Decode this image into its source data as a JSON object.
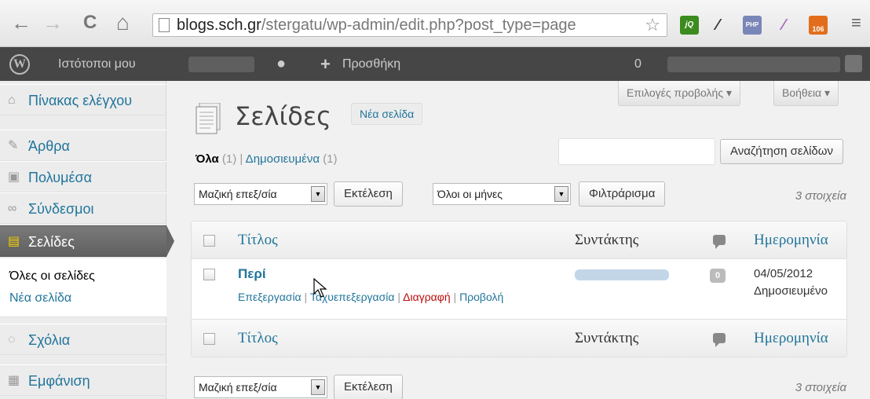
{
  "browser": {
    "back": "←",
    "forward": "→",
    "reload": "C",
    "home": "⌂",
    "url_host": "blogs.sch.gr",
    "url_path": "/stergatu/wp-admin/edit.php?post_type=page",
    "star": "☆",
    "extensions": [
      "jQ",
      "PHP",
      "106"
    ],
    "menu": "≡"
  },
  "adminbar": {
    "my_sites": "Ιστότοποι μου",
    "add_new": "Προσθήκη",
    "plus": "+",
    "count": "0"
  },
  "sidebar": {
    "items": [
      {
        "label": "Πίνακας ελέγχου",
        "icon": "⌂"
      },
      {
        "label": "Άρθρα",
        "icon": "✎"
      },
      {
        "label": "Πολυμέσα",
        "icon": "▣"
      },
      {
        "label": "Σύνδεσμοι",
        "icon": "∞"
      },
      {
        "label": "Σελίδες",
        "icon": "▤"
      },
      {
        "label": "Σχόλια",
        "icon": "◌"
      },
      {
        "label": "Εμφάνιση",
        "icon": "▦"
      }
    ],
    "submenu": [
      "Όλες οι σελίδες",
      "Νέα σελίδα"
    ]
  },
  "screen_options": "Επιλογές προβολής ▾",
  "help": "Βοήθεια ▾",
  "page_title": "Σελίδες",
  "add_new_page": "Νέα σελίδα",
  "filters": {
    "all_label": "Όλα",
    "all_count": " (1)",
    "sep": " | ",
    "published_label": "Δημοσιευμένα",
    "published_count": " (1)"
  },
  "search": {
    "placeholder": "",
    "button": "Αναζήτηση σελίδων"
  },
  "bulk": {
    "select_value": "Μαζική επεξ/σία",
    "apply": "Εκτέλεση"
  },
  "dates": {
    "select_value": "Όλοι οι μήνες",
    "filter": "Φιλτράρισμα"
  },
  "item_count": "3 στοιχεία",
  "table": {
    "col_title": "Τίτλος",
    "col_author": "Συντάκτης",
    "col_date": "Ημερομηνία",
    "row": {
      "title": "Περί",
      "actions": [
        "Επεξεργασία",
        "Ταχυεπεξεργασία",
        "Διαγραφή",
        "Προβολή"
      ],
      "comments": "0",
      "date": "04/05/2012",
      "status": "Δημοσιευμένο"
    }
  }
}
